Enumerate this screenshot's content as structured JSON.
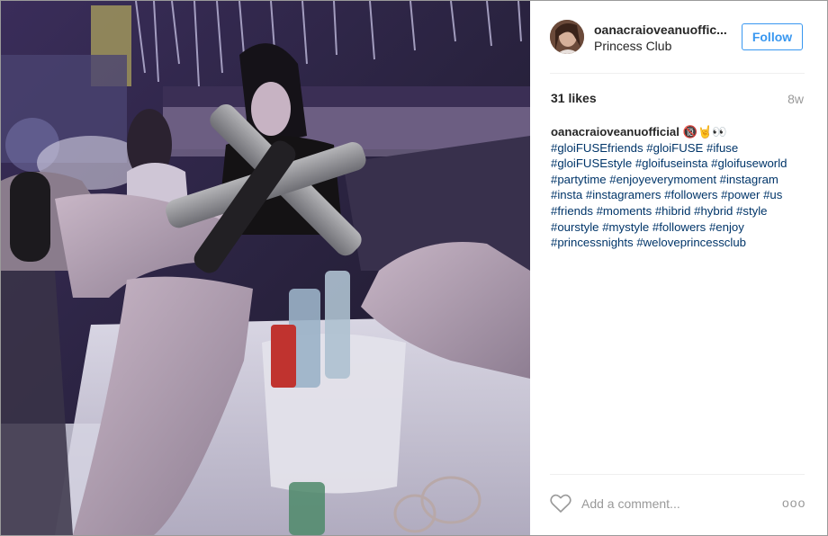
{
  "post": {
    "username": "oanacraioveanuoffic...",
    "location": "Princess Club",
    "follow_label": "Follow",
    "likes": "31 likes",
    "age": "8w",
    "caption_user": "oanacraioveanuofficial",
    "caption_emoji": "🔞🤘👀",
    "hashtags": [
      "#gloiFUSEfriends",
      "#gloiFUSE",
      "#ifuse",
      "#gloiFUSEstyle",
      "#gloifuseinsta",
      "#gloifuseworld",
      "#partytime",
      "#enjoyeverymoment",
      "#instagram",
      "#insta",
      "#instagramers",
      "#followers",
      "#power",
      "#us",
      "#friends",
      "#moments",
      "#hibrid",
      "#hybrid",
      "#style",
      "#ourstyle",
      "#mystyle",
      "#followers",
      "#enjoy",
      "#princessnights",
      "#weloveprincessclub"
    ],
    "comment_placeholder": "Add a comment...",
    "more_label": "ooo"
  },
  "icons": {
    "heart": "heart-icon",
    "more": "more-options-icon"
  },
  "colors": {
    "link": "#003569",
    "follow": "#3897f0",
    "muted": "#999999",
    "text": "#262626"
  }
}
